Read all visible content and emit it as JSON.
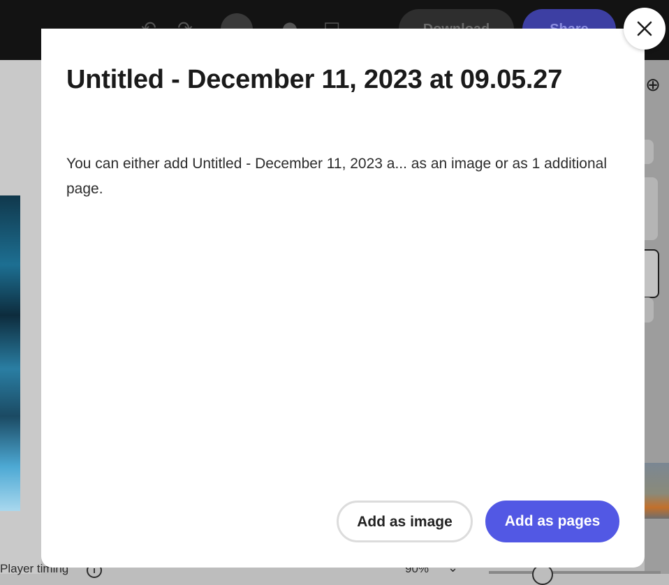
{
  "background": {
    "topbar": {
      "download_label": "Download",
      "share_label": "Share"
    },
    "bottom_bar": {
      "label": "Player timing",
      "zoom": "90%"
    }
  },
  "dialog": {
    "title": "Untitled - December 11, 2023 at 09.05.27",
    "body": "You can either add Untitled - December 11, 2023 a... as an image or as 1 additional page.",
    "add_as_image_label": "Add as image",
    "add_as_pages_label": "Add as pages",
    "close_icon": "close-icon"
  },
  "colors": {
    "primary_button": "#5258e4",
    "topbar": "#131313"
  }
}
